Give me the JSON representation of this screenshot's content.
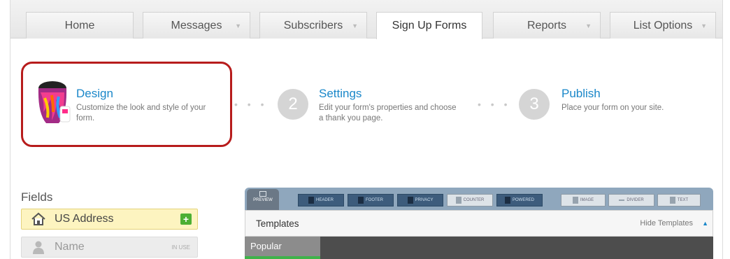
{
  "tabs": [
    {
      "label": "Home",
      "dropdown": false,
      "active": false
    },
    {
      "label": "Messages",
      "dropdown": true,
      "active": false
    },
    {
      "label": "Subscribers",
      "dropdown": true,
      "active": false
    },
    {
      "label": "Sign Up Forms",
      "dropdown": false,
      "active": true
    },
    {
      "label": "Reports",
      "dropdown": true,
      "active": false
    },
    {
      "label": "List Options",
      "dropdown": true,
      "active": false
    }
  ],
  "steps": [
    {
      "number": "",
      "title": "Design",
      "description": "Customize the look and style of your form.",
      "highlighted": true
    },
    {
      "number": "2",
      "title": "Settings",
      "description": "Edit your form's properties and choose a thank you page.",
      "highlighted": false
    },
    {
      "number": "3",
      "title": "Publish",
      "description": "Place your form on your site.",
      "highlighted": false
    }
  ],
  "fields": {
    "heading": "Fields",
    "items": [
      {
        "label": "US Address",
        "icon": "house-icon",
        "action": "+",
        "status": ""
      },
      {
        "label": "Name",
        "icon": "person-icon",
        "action": "",
        "status": "IN USE"
      }
    ]
  },
  "editor": {
    "preview_label": "PREVIEW",
    "toolbar_buttons": [
      {
        "label": "HEADER",
        "icon": "arrow-up-icon",
        "style": "dark"
      },
      {
        "label": "FOOTER",
        "icon": "arrow-down-icon",
        "style": "dark"
      },
      {
        "label": "PRIVACY",
        "icon": "check-icon",
        "style": "dark"
      },
      {
        "label": "COUNTER",
        "icon": "counter-icon",
        "style": "light"
      },
      {
        "label": "POWERED",
        "icon": "powered-icon",
        "style": "dark"
      },
      {
        "label": "IMAGE",
        "icon": "image-icon",
        "style": "light"
      },
      {
        "label": "DIVIDER",
        "icon": "divider-icon",
        "style": "light"
      },
      {
        "label": "TEXT",
        "icon": "text-icon",
        "style": "light"
      }
    ],
    "templates_title": "Templates",
    "hide_templates": "Hide Templates",
    "category_tab": "Popular"
  },
  "colors": {
    "accent_blue": "#1a87c9",
    "highlight_red": "#b71c1c",
    "toolbar_blue": "#8fa7bd",
    "add_green": "#4caf33"
  }
}
